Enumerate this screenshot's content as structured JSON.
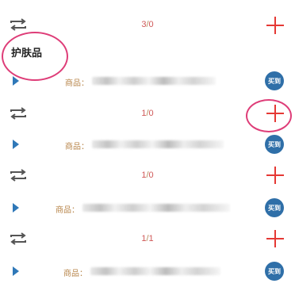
{
  "section": {
    "title": "护肤品"
  },
  "rows": [
    {
      "count_left": "3",
      "count_right": "0"
    },
    {
      "count_left": "1",
      "count_right": "0"
    },
    {
      "count_left": "1",
      "count_right": "0"
    },
    {
      "count_left": "1",
      "count_right": "1"
    }
  ],
  "items": [
    {
      "label": "商品：",
      "button": "买到"
    },
    {
      "label": "商品：",
      "button": "买到"
    },
    {
      "label": "商品：",
      "button": "买到"
    },
    {
      "label": "商品：",
      "button": "买到"
    }
  ],
  "separator": "/",
  "colors": {
    "accent_red": "#e53935",
    "button_blue": "#2f6fa8",
    "annotation": "#d81b60"
  }
}
